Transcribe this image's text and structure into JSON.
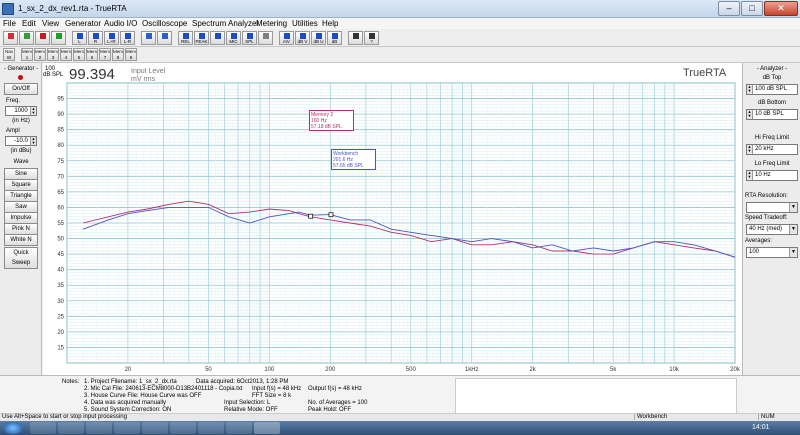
{
  "window": {
    "title": "1_sx_2_dx_rev1.rta - TrueRTA"
  },
  "menu": [
    "File",
    "Edit",
    "View",
    "Generator",
    "Audio I/O",
    "Oscilloscope",
    "Spectrum Analyzer",
    "Metering",
    "Utilities",
    "Help"
  ],
  "toolbar1": [
    {
      "label": "",
      "color": "#d23030"
    },
    {
      "label": "",
      "color": "#30a030"
    },
    {
      "label": "",
      "color": "#c02020"
    },
    {
      "label": "",
      "color": "#20a020"
    },
    {
      "label": "L",
      "color": "#1a4fc4"
    },
    {
      "label": "R",
      "color": "#1a4fc4"
    },
    {
      "label": "L+R",
      "color": "#1a4fc4"
    },
    {
      "label": "L-R",
      "color": "#1a4fc4"
    },
    {
      "label": "",
      "color": "#3060c0"
    },
    {
      "label": "",
      "color": "#3060c0"
    },
    {
      "label": "REL",
      "color": "#1a4fc4"
    },
    {
      "label": "PEAK HOLD",
      "color": "#1a4fc4"
    },
    {
      "label": "",
      "color": "#1a4fc4"
    },
    {
      "label": "MIC CAL",
      "color": "#1a4fc4"
    },
    {
      "label": "SPL",
      "color": "#1a4fc4"
    },
    {
      "label": "",
      "color": "#808080"
    },
    {
      "label": "mV",
      "color": "#1a4fc4"
    },
    {
      "label": "dB V",
      "color": "#1a4fc4"
    },
    {
      "label": "dB U",
      "color": "#1a4fc4"
    },
    {
      "label": "dB SPL",
      "color": "#1a4fc4"
    },
    {
      "label": "",
      "color": "#333333"
    },
    {
      "label": "?",
      "color": "#333333"
    }
  ],
  "toolbar2": [
    {
      "label": "Nav W",
      "color": "#1a4fc4"
    },
    {
      "label": "Mem 1",
      "color": "#e04040"
    },
    {
      "label": "Mem 2",
      "color": "#1a4fc4"
    },
    {
      "label": "Mem 3",
      "color": "#8a8a00"
    },
    {
      "label": "Mem 4",
      "color": "#a000a0"
    },
    {
      "label": "Mem 5",
      "color": "#00a0a0"
    },
    {
      "label": "Mem 6",
      "color": "#e07000"
    },
    {
      "label": "Mem 7",
      "color": "#40a040"
    },
    {
      "label": "Mem 8",
      "color": "#804000"
    },
    {
      "label": "Mem 9",
      "color": "#4040ff"
    }
  ],
  "generator": {
    "title": "- Generator -",
    "onoff": "On/Off",
    "freq_label": "Freq.",
    "freq_value": "1000",
    "freq_unit": "(in Hz)",
    "ampl_label": "Ampl",
    "ampl_value": "-10.0",
    "ampl_unit": "(in dBu)",
    "wave_label": "Wave",
    "waves": [
      "Sine",
      "Square",
      "Triangle",
      "Saw",
      "Impulse",
      "Pink N",
      "White N"
    ],
    "quick_sweep": "Quick Sweep"
  },
  "analyzer": {
    "title": "- Analyzer -",
    "db_top_label": "dB Top",
    "db_top_value": "100 dB SPL",
    "db_bottom_label": "dB Bottom",
    "db_bottom_value": "10 dB SPL",
    "hi_label": "Hi Freq Limit",
    "hi_value": "20 kHz",
    "lo_label": "Lo Freq Limit",
    "lo_value": "10 Hz",
    "res_label": "RTA Resolution:",
    "res_value": "",
    "speed_label": "Speed Tradeoff:",
    "speed_value": "40 Hz (med)",
    "avg_label": "Averages:",
    "avg_value": "100"
  },
  "readout": {
    "top_label": "100",
    "unit_label": "dB SPL",
    "value": "99.394",
    "input_level": "Input Level",
    "input_unit": "mV rms",
    "logo": "TrueRTA"
  },
  "chart_data": {
    "type": "line",
    "xscale": "log",
    "xlim": [
      10,
      20000
    ],
    "ylim": [
      10,
      100
    ],
    "grid": true,
    "y_ticks": [
      15,
      20,
      25,
      30,
      35,
      40,
      45,
      50,
      55,
      60,
      65,
      70,
      75,
      80,
      85,
      90,
      95
    ],
    "x_ticks": [
      {
        "v": 20,
        "t": "20"
      },
      {
        "v": 50,
        "t": "50"
      },
      {
        "v": 100,
        "t": "100"
      },
      {
        "v": 200,
        "t": "200"
      },
      {
        "v": 500,
        "t": "500"
      },
      {
        "v": 1000,
        "t": "1kHz"
      },
      {
        "v": 2000,
        "t": "2k"
      },
      {
        "v": 5000,
        "t": "5k"
      },
      {
        "v": 10000,
        "t": "10k"
      },
      {
        "v": 20000,
        "t": "20k"
      }
    ],
    "series": [
      {
        "name": "Memory 2",
        "color": "#b03070",
        "x": [
          12,
          16,
          20,
          25,
          32,
          40,
          45,
          50,
          63,
          80,
          100,
          125,
          140,
          160,
          200,
          250,
          315,
          400,
          500,
          630,
          800,
          1000,
          1250,
          1600,
          2000,
          2500,
          3150,
          4000,
          5000,
          6300,
          8000,
          10000,
          12500,
          16000,
          20000
        ],
        "y": [
          55,
          57,
          58.5,
          59.5,
          61,
          62,
          61.5,
          61,
          58,
          58.5,
          59.5,
          59,
          58,
          57,
          56,
          55,
          54,
          52,
          51,
          49,
          50,
          48,
          48,
          49,
          48,
          46,
          46,
          45,
          45,
          47,
          49,
          48,
          47,
          46,
          44
        ]
      },
      {
        "name": "Workbench",
        "color": "#4a55c0",
        "x": [
          12,
          16,
          20,
          25,
          32,
          40,
          50,
          63,
          80,
          100,
          125,
          140,
          160,
          200,
          250,
          315,
          400,
          500,
          630,
          800,
          1000,
          1250,
          1600,
          2000,
          2500,
          3150,
          4000,
          5000,
          6300,
          8000,
          10000,
          12500,
          16000,
          20000
        ],
        "y": [
          53,
          56,
          58,
          59,
          60,
          60,
          60,
          57,
          55,
          57,
          58,
          58.5,
          57.5,
          57.7,
          56,
          56,
          53,
          52,
          51,
          50,
          49,
          50,
          49,
          47,
          48,
          46,
          47,
          46,
          47,
          49,
          49,
          48,
          46,
          44
        ]
      }
    ],
    "annotations": [
      {
        "title": "Memory 2",
        "freq": "160 Hz",
        "level": "57.18 dB SPL",
        "x": 160,
        "y": 57.18
      },
      {
        "title": "Workbench",
        "freq": "201.6 Hz",
        "level": "57.65 dB SPL",
        "x": 201.6,
        "y": 57.65
      }
    ]
  },
  "notes": {
    "label": "Notes:",
    "l1": "1. Project Filename: 1_sx_2_dx.rta",
    "l1b": "Data acquired: 6Oct2013, 1:28 PM",
    "l2": "2. Mic Cal File: 240613-ECM8000-D13B2401118 - Copia.txt",
    "l2b": "Input f(s) = 48 kHz",
    "l2c": "Output f(s) = 48 kHz",
    "l3": "3. House Curve File: House Curve was OFF",
    "l3b": "FFT Size = 8 k",
    "l4": "4. Data was acquired manually",
    "l4b": "Input Selection: L",
    "l4c": "No. of Averages = 100",
    "l5": "5. Sound System Correction: ON",
    "l5b": "Relative Mode: OFF",
    "l5c": "Peak Hold: OFF"
  },
  "status": {
    "text": "Use Alt+Space to start or stop input processing",
    "memory": "Workbench",
    "num": "NUM"
  },
  "taskbar": {
    "clock": "14:01"
  }
}
